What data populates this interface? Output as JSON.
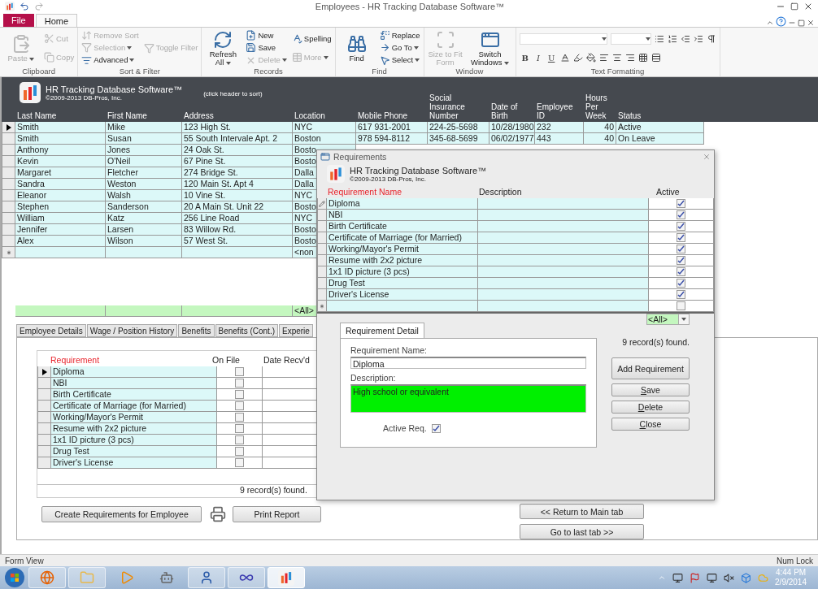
{
  "title_bar": {
    "title": "Employees  -  HR Tracking Database Software™"
  },
  "ribbon": {
    "tabs": [
      {
        "label": "File",
        "kind": "file",
        "selected": false
      },
      {
        "label": "Home",
        "kind": "plain",
        "selected": true
      }
    ],
    "groups": [
      {
        "label": "Clipboard",
        "columns": [
          [
            {
              "label": "Paste",
              "kind": "paste",
              "large": true,
              "disabled": true,
              "dropdown": true
            }
          ],
          [
            {
              "label": "Cut",
              "kind": "cut",
              "disabled": true,
              "dropdown": false
            },
            {
              "label": "Copy",
              "kind": "copy",
              "disabled": true,
              "dropdown": false
            }
          ]
        ]
      },
      {
        "label": "Sort & Filter",
        "columns": [
          [
            {
              "label": "Remove Sort",
              "kind": "sort",
              "disabled": true,
              "dropdown": false
            },
            {
              "label": "Selection",
              "kind": "selection",
              "disabled": true,
              "dropdown": true
            },
            {
              "label": "Advanced",
              "kind": "advanced",
              "disabled": false,
              "dropdown": true
            }
          ],
          [
            {
              "label": "Toggle Filter",
              "kind": "filter",
              "disabled": true,
              "dropdown": false
            }
          ]
        ]
      },
      {
        "label": "Records",
        "columns": [
          [
            {
              "label": "Refresh All",
              "kind": "refresh",
              "large": true,
              "disabled": false,
              "dropdown": true
            }
          ],
          [
            {
              "label": "New",
              "kind": "new",
              "disabled": false,
              "dropdown": false
            },
            {
              "label": "Save",
              "kind": "save",
              "disabled": false,
              "dropdown": false
            },
            {
              "label": "Delete",
              "kind": "delete",
              "disabled": true,
              "dropdown": true
            }
          ],
          [
            {
              "label": "Spelling",
              "kind": "spelling",
              "disabled": false,
              "dropdown": false
            },
            {
              "label": "More",
              "kind": "more",
              "disabled": true,
              "dropdown": true
            }
          ]
        ]
      },
      {
        "label": "Find",
        "columns": [
          [
            {
              "label": "Find",
              "kind": "find",
              "large": true,
              "disabled": false,
              "dropdown": false
            }
          ],
          [
            {
              "label": "Replace",
              "kind": "replace",
              "disabled": false,
              "dropdown": false
            },
            {
              "label": "Go To",
              "kind": "goto",
              "disabled": false,
              "dropdown": true
            },
            {
              "label": "Select",
              "kind": "select",
              "disabled": false,
              "dropdown": true
            }
          ]
        ]
      },
      {
        "label": "Window",
        "columns": [
          [
            {
              "label": "Size to Fit Form",
              "kind": "fit",
              "large": true,
              "disabled": true,
              "dropdown": false
            }
          ],
          [
            {
              "label": "Switch Windows",
              "kind": "windows",
              "large": true,
              "disabled": false,
              "dropdown": true
            }
          ]
        ]
      }
    ],
    "text_formatting": {
      "label": "Text Formatting",
      "format_buttons": [
        "B",
        "I",
        "U"
      ]
    }
  },
  "form": {
    "app_title": "HR Tracking Database Software™",
    "copyright": "©2009-2013 DB-Pros, Inc.",
    "sort_hint": "(click header to sort)",
    "columns": [
      "Last Name",
      "First Name",
      "Address",
      "Location",
      "Mobile Phone",
      "Social Insurance Number",
      "Date of Birth",
      "Employee ID",
      "Hours Per Week",
      "Status"
    ],
    "rows": [
      {
        "selected": true,
        "cells": [
          "Smith",
          "Mike",
          "123 High St.",
          "NYC",
          "617 931-2001",
          "224-25-5698",
          "10/28/1980",
          "232",
          "40",
          "Active"
        ]
      },
      {
        "selected": false,
        "cells": [
          "Smith",
          "Susan",
          "55 South Intervale Apt. 2",
          "Boston",
          "978 594-8112",
          "345-68-5699",
          "06/02/1977",
          "443",
          "40",
          "On Leave"
        ]
      },
      {
        "selected": false,
        "cells": [
          "Anthony",
          "Jones",
          "24 Oak St.",
          "Bosto"
        ]
      },
      {
        "selected": false,
        "cells": [
          "Kevin",
          "O'Neil",
          "67 Pine St.",
          "Bosto"
        ]
      },
      {
        "selected": false,
        "cells": [
          "Margaret",
          "Fletcher",
          "274 Bridge St.",
          "Dalla"
        ]
      },
      {
        "selected": false,
        "cells": [
          "Sandra",
          "Weston",
          "120 Main St. Apt 4",
          "Dalla"
        ]
      },
      {
        "selected": false,
        "cells": [
          "Eleanor",
          "Walsh",
          "10 Vine St.",
          "NYC"
        ]
      },
      {
        "selected": false,
        "cells": [
          "Stephen",
          "Sanderson",
          "20 A Main St. Unit 22",
          "Bosto"
        ]
      },
      {
        "selected": false,
        "cells": [
          "William",
          "Katz",
          "256 Line Road",
          "NYC"
        ]
      },
      {
        "selected": false,
        "cells": [
          "Jennifer",
          "Larsen",
          "83 Willow Rd.",
          "Bosto"
        ]
      },
      {
        "selected": false,
        "cells": [
          "Alex",
          "Wilson",
          "57 West St.",
          "Bosto"
        ]
      }
    ],
    "new_row": {
      "location": "<non"
    },
    "filter_row": {
      "location": "<All>"
    },
    "tabs": [
      {
        "label": "Employee Details",
        "selected": false
      },
      {
        "label": "Wage / Position History",
        "selected": false
      },
      {
        "label": "Benefits",
        "selected": false
      },
      {
        "label": "Benefits (Cont.)",
        "selected": false
      },
      {
        "label": "Experie",
        "selected": false
      }
    ],
    "requirements": {
      "columns": [
        "Requirement",
        "On File",
        "Date Recv'd"
      ],
      "rows": [
        {
          "name": "Diploma",
          "on_file": false,
          "selected": true
        },
        {
          "name": "NBI",
          "on_file": false,
          "selected": false
        },
        {
          "name": "Birth Certificate",
          "on_file": false,
          "selected": false
        },
        {
          "name": "Certificate of Marriage (for Married)",
          "on_file": false,
          "selected": false
        },
        {
          "name": "Working/Mayor's Permit",
          "on_file": false,
          "selected": false
        },
        {
          "name": "Resume with 2x2 picture",
          "on_file": false,
          "selected": false
        },
        {
          "name": "1x1 ID picture (3 pcs)",
          "on_file": false,
          "selected": false
        },
        {
          "name": "Drug Test",
          "on_file": false,
          "selected": false
        },
        {
          "name": "Driver's License",
          "on_file": false,
          "selected": false
        }
      ],
      "count": "9 record(s) found."
    },
    "buttons": [
      "Create Requirements for Employee",
      "Print Report"
    ],
    "nav_buttons": [
      "<< Return to Main tab",
      "Go to last tab >>"
    ]
  },
  "dialog": {
    "title": "Requirements",
    "app_title": "HR Tracking Database Software™",
    "copyright": "©2009-2013 DB-Pros, Inc.",
    "columns": [
      "Requirement Name",
      "Description",
      "Active"
    ],
    "rows": [
      {
        "name": "Diploma",
        "active": true,
        "editing": true
      },
      {
        "name": "NBI",
        "active": true,
        "editing": false
      },
      {
        "name": "Birth Certificate",
        "active": true,
        "editing": false
      },
      {
        "name": "Certificate of Marriage (for Married)",
        "active": true,
        "editing": false
      },
      {
        "name": "Working/Mayor's Permit",
        "active": true,
        "editing": false
      },
      {
        "name": "Resume with 2x2 picture",
        "active": true,
        "editing": false
      },
      {
        "name": "1x1 ID picture (3 pcs)",
        "active": true,
        "editing": false
      },
      {
        "name": "Drug Test",
        "active": true,
        "editing": false
      },
      {
        "name": "Driver's License",
        "active": true,
        "editing": false
      }
    ],
    "new_row": {
      "active": false
    },
    "filter": "<All>",
    "detail_tab": "Requirement Detail",
    "name_label": "Requirement Name:",
    "name_value": "Diploma",
    "description_label": "Description:",
    "description_value": "High school or equivalent",
    "active_label": "Active Req.",
    "active_checked": true,
    "count": "9 record(s) found.",
    "buttons": [
      "Add Requirement",
      "Save",
      "Delete",
      "Close"
    ]
  },
  "status_bar": {
    "left": "Form View",
    "right": "Num Lock"
  },
  "taskbar": {
    "apps": [
      {
        "kind": "browser",
        "running": true,
        "selected": false
      },
      {
        "kind": "folder",
        "running": true,
        "selected": false
      },
      {
        "kind": "media",
        "running": false,
        "selected": false
      },
      {
        "kind": "robot",
        "running": false,
        "selected": false
      },
      {
        "kind": "person",
        "running": true,
        "selected": false
      },
      {
        "kind": "loop",
        "running": true,
        "selected": false
      },
      {
        "kind": "hr",
        "running": true,
        "selected": true
      }
    ],
    "time": "4:44 PM",
    "date": "2/9/2014"
  }
}
